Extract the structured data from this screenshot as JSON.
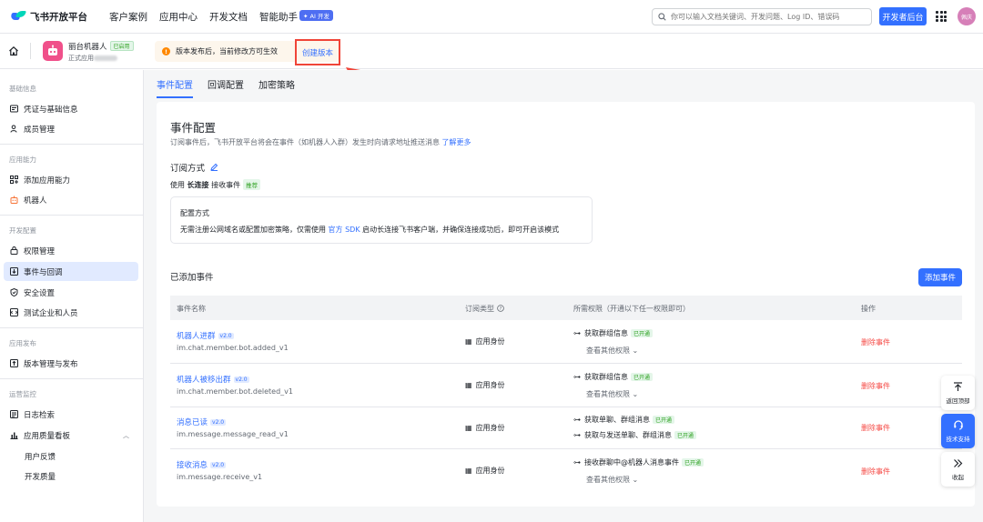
{
  "topbar": {
    "logo_text": "飞书开放平台",
    "nav": [
      {
        "label": "客户案例"
      },
      {
        "label": "应用中心"
      },
      {
        "label": "开发文档"
      },
      {
        "label": "智能助手",
        "badge": "✦ AI 开发"
      }
    ],
    "search_placeholder": "你可以输入文档关键词、开发问题、Log ID、错误码",
    "dev_button": "开发者后台",
    "avatar_text": "佩庆"
  },
  "app": {
    "name": "丽台机器人",
    "status": "已启用",
    "sub_prefix": "正式应用",
    "notice": "版本发布后，当前修改方可生效",
    "create_version": "创建版本"
  },
  "sidebar": {
    "groups": [
      {
        "label": "基础信息",
        "items": [
          {
            "label": "凭证与基础信息",
            "icon": "id-card-icon"
          },
          {
            "label": "成员管理",
            "icon": "user-icon"
          }
        ]
      },
      {
        "label": "应用能力",
        "items": [
          {
            "label": "添加应用能力",
            "icon": "apps-icon"
          },
          {
            "label": "机器人",
            "icon": "robot-icon"
          }
        ]
      },
      {
        "label": "开发配置",
        "items": [
          {
            "label": "权限管理",
            "icon": "lock-icon"
          },
          {
            "label": "事件与回调",
            "icon": "event-icon",
            "active": true
          },
          {
            "label": "安全设置",
            "icon": "shield-icon"
          },
          {
            "label": "测试企业和人员",
            "icon": "test-icon"
          }
        ]
      },
      {
        "label": "应用发布",
        "items": [
          {
            "label": "版本管理与发布",
            "icon": "upload-icon"
          }
        ]
      },
      {
        "label": "运营监控",
        "items": [
          {
            "label": "日志检索",
            "icon": "log-icon"
          },
          {
            "label": "应用质量看板",
            "icon": "chart-icon"
          }
        ]
      }
    ],
    "sub_items": [
      "用户反馈",
      "开发质量"
    ]
  },
  "main": {
    "tabs": [
      {
        "label": "事件配置",
        "active": true
      },
      {
        "label": "回调配置"
      },
      {
        "label": "加密策略"
      }
    ],
    "title": "事件配置",
    "desc": "订阅事件后，飞书开放平台将会在事件（如机器人入群）发生时向请求地址推送消息",
    "learn_more": "了解更多",
    "subscribe_title": "订阅方式",
    "mode_prefix": "使用",
    "mode_bold": "长连接",
    "mode_suffix": "接收事件",
    "mode_tag": "推荐",
    "config_title": "配置方式",
    "config_desc_a": "无需注册公网域名或配置加密策略，仅需使用",
    "config_desc_link": "官方 SDK",
    "config_desc_b": "启动长连接飞书客户端，并确保连接成功后，即可开启该模式",
    "added_title": "已添加事件",
    "add_button": "添加事件",
    "table_headers": {
      "name": "事件名称",
      "type": "订阅类型",
      "perm": "所需权限（开通以下任一权限即可）",
      "op": "操作"
    },
    "rows": [
      {
        "name": "机器人进群",
        "ver": "v2.0",
        "id": "im.chat.member.bot.added_v1",
        "type": "应用身份",
        "perm1": "获取群组信息",
        "perm1_tag": "已开通",
        "perm2": "",
        "perm2_tag": "",
        "more": "查看其他权限",
        "op": "删除事件"
      },
      {
        "name": "机器人被移出群",
        "ver": "v2.0",
        "id": "im.chat.member.bot.deleted_v1",
        "type": "应用身份",
        "perm1": "获取群组信息",
        "perm1_tag": "已开通",
        "perm2": "",
        "perm2_tag": "",
        "more": "查看其他权限",
        "op": "删除事件"
      },
      {
        "name": "消息已读",
        "ver": "v2.0",
        "id": "im.message.message_read_v1",
        "type": "应用身份",
        "perm1": "获取单聊、群组消息",
        "perm1_tag": "已开通",
        "perm2": "获取与发送单聊、群组消息",
        "perm2_tag": "已开通",
        "more": "",
        "op": "删除事件"
      },
      {
        "name": "接收消息",
        "ver": "v2.0",
        "id": "im.message.receive_v1",
        "type": "应用身份",
        "perm1": "接收群聊中@机器人消息事件",
        "perm1_tag": "已开通",
        "perm2": "",
        "perm2_tag": "",
        "more": "查看其他权限",
        "op": "删除事件"
      }
    ]
  },
  "float": {
    "top": "返回顶部",
    "support": "技术支持",
    "collapse": "收起"
  }
}
